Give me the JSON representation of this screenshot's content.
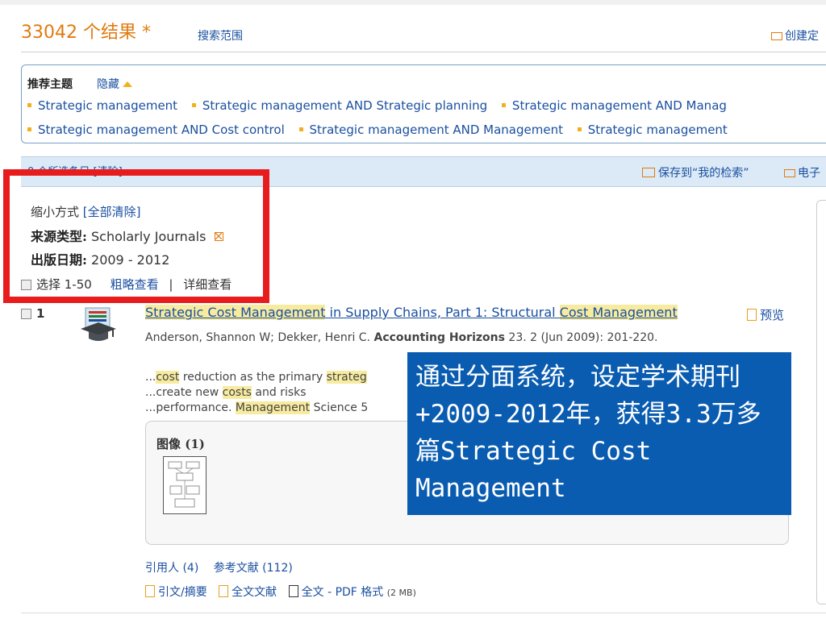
{
  "header": {
    "result_count": "33042 个结果 *",
    "search_scope": "搜索范围",
    "create_alert": "创建定"
  },
  "recommended": {
    "title": "推荐主题",
    "hide": "隐藏",
    "row1": [
      "Strategic management",
      "Strategic management AND Strategic planning",
      "Strategic management AND Manag"
    ],
    "row2": [
      "Strategic management AND Cost control",
      "Strategic management AND Management",
      "Strategic management"
    ]
  },
  "selection_bar": {
    "selected": "0 个所选条目 [清除]",
    "save_search": "保存到“我的检索”",
    "email": "电子"
  },
  "facets": {
    "narrow_by": "缩小方式",
    "clear_all": "[全部清除]",
    "source_type_label": "来源类型:",
    "source_type_value": "Scholarly Journals",
    "pub_date_label": "出版日期:",
    "pub_date_value": "2009 - 2012"
  },
  "list_controls": {
    "select_range": "选择 1-50",
    "brief_view": "粗略查看",
    "separator": "|",
    "detailed_view": "详细查看"
  },
  "result": {
    "number": "1",
    "title_part1": "Strategic Cost Management",
    "title_part2": " in Supply Chains, Part 1: Structural ",
    "title_part3": "Cost Management",
    "preview": "预览",
    "authors": "Anderson, Shannon W; Dekker, Henri C.",
    "journal": "Accounting Horizons",
    "citation": "23. 2  (Jun 2009): 201-220.",
    "snippet1_pre": "...",
    "snippet1_hl": "cost",
    "snippet1_post": " reduction as the primary ",
    "snippet1_hl2": "strateg",
    "snippet2_pre": "...create new ",
    "snippet2_hl": "costs",
    "snippet2_post": " and risks",
    "snippet3_pre": "...performance. ",
    "snippet3_hl": "Management",
    "snippet3_post": " Science 5",
    "images_label": "图像 (1)",
    "cited_by": "引用人 (4)",
    "references": "参考文献 (112)",
    "abstract": "引文/摘要",
    "full_text": "全文文献",
    "pdf": "全文 - PDF 格式",
    "pdf_size": "(2 MB)"
  },
  "callout": {
    "text": "通过分面系统，设定学术期刊+2009-2012年，获得3.3万多篇Strategic Cost Management"
  },
  "colors": {
    "accent_orange": "#e07b10",
    "link_blue": "#1a4fa0",
    "highlight_red": "#e81c1c",
    "callout_blue": "#0a5cb0"
  }
}
